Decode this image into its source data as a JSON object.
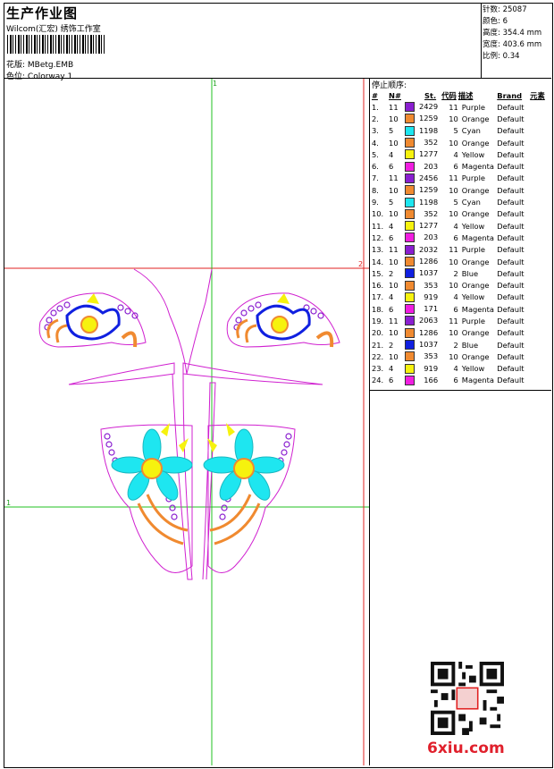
{
  "header": {
    "title": "生产作业图",
    "company": "Wilcom(汇宏) 绣饰工作室",
    "pattern_label": "花版:",
    "pattern_value": "MBetg.EMB",
    "colorway_label": "色位:",
    "colorway_value": "Colorway 1"
  },
  "stats": {
    "stitches_label": "针数:",
    "stitches": "25087",
    "colors_label": "颜色:",
    "colors": "6",
    "height_label": "高度:",
    "height": "354.4 mm",
    "width_label": "宽度:",
    "width": "403.6 mm",
    "scale_label": "比例:",
    "scale": "0.34"
  },
  "stop_sequence": {
    "title": "停止顺序:",
    "headers": [
      "#",
      "N#",
      "St.",
      "代码",
      "描述",
      "Brand",
      "元素"
    ],
    "rows": [
      {
        "idx": "1.",
        "n": "11",
        "color": "#8a1fd0",
        "st": "2429",
        "code": "11",
        "desc": "Purple",
        "brand": "Default"
      },
      {
        "idx": "2.",
        "n": "10",
        "color": "#f08a30",
        "st": "1259",
        "code": "10",
        "desc": "Orange",
        "brand": "Default"
      },
      {
        "idx": "3.",
        "n": "5",
        "color": "#1ee6f0",
        "st": "1198",
        "code": "5",
        "desc": "Cyan",
        "brand": "Default"
      },
      {
        "idx": "4.",
        "n": "10",
        "color": "#f08a30",
        "st": "352",
        "code": "10",
        "desc": "Orange",
        "brand": "Default"
      },
      {
        "idx": "5.",
        "n": "4",
        "color": "#f6f20e",
        "st": "1277",
        "code": "4",
        "desc": "Yellow",
        "brand": "Default"
      },
      {
        "idx": "6.",
        "n": "6",
        "color": "#f01ee0",
        "st": "203",
        "code": "6",
        "desc": "Magenta",
        "brand": "Default"
      },
      {
        "idx": "7.",
        "n": "11",
        "color": "#8a1fd0",
        "st": "2456",
        "code": "11",
        "desc": "Purple",
        "brand": "Default"
      },
      {
        "idx": "8.",
        "n": "10",
        "color": "#f08a30",
        "st": "1259",
        "code": "10",
        "desc": "Orange",
        "brand": "Default"
      },
      {
        "idx": "9.",
        "n": "5",
        "color": "#1ee6f0",
        "st": "1198",
        "code": "5",
        "desc": "Cyan",
        "brand": "Default"
      },
      {
        "idx": "10.",
        "n": "10",
        "color": "#f08a30",
        "st": "352",
        "code": "10",
        "desc": "Orange",
        "brand": "Default"
      },
      {
        "idx": "11.",
        "n": "4",
        "color": "#f6f20e",
        "st": "1277",
        "code": "4",
        "desc": "Yellow",
        "brand": "Default"
      },
      {
        "idx": "12.",
        "n": "6",
        "color": "#f01ee0",
        "st": "203",
        "code": "6",
        "desc": "Magenta",
        "brand": "Default"
      },
      {
        "idx": "13.",
        "n": "11",
        "color": "#8a1fd0",
        "st": "2032",
        "code": "11",
        "desc": "Purple",
        "brand": "Default"
      },
      {
        "idx": "14.",
        "n": "10",
        "color": "#f08a30",
        "st": "1286",
        "code": "10",
        "desc": "Orange",
        "brand": "Default"
      },
      {
        "idx": "15.",
        "n": "2",
        "color": "#1020e0",
        "st": "1037",
        "code": "2",
        "desc": "Blue",
        "brand": "Default"
      },
      {
        "idx": "16.",
        "n": "10",
        "color": "#f08a30",
        "st": "353",
        "code": "10",
        "desc": "Orange",
        "brand": "Default"
      },
      {
        "idx": "17.",
        "n": "4",
        "color": "#f6f20e",
        "st": "919",
        "code": "4",
        "desc": "Yellow",
        "brand": "Default"
      },
      {
        "idx": "18.",
        "n": "6",
        "color": "#f01ee0",
        "st": "171",
        "code": "6",
        "desc": "Magenta",
        "brand": "Default"
      },
      {
        "idx": "19.",
        "n": "11",
        "color": "#8a1fd0",
        "st": "2063",
        "code": "11",
        "desc": "Purple",
        "brand": "Default"
      },
      {
        "idx": "20.",
        "n": "10",
        "color": "#f08a30",
        "st": "1286",
        "code": "10",
        "desc": "Orange",
        "brand": "Default"
      },
      {
        "idx": "21.",
        "n": "2",
        "color": "#1020e0",
        "st": "1037",
        "code": "2",
        "desc": "Blue",
        "brand": "Default"
      },
      {
        "idx": "22.",
        "n": "10",
        "color": "#f08a30",
        "st": "353",
        "code": "10",
        "desc": "Orange",
        "brand": "Default"
      },
      {
        "idx": "23.",
        "n": "4",
        "color": "#f6f20e",
        "st": "919",
        "code": "4",
        "desc": "Yellow",
        "brand": "Default"
      },
      {
        "idx": "24.",
        "n": "6",
        "color": "#f01ee0",
        "st": "166",
        "code": "6",
        "desc": "Magenta",
        "brand": "Default"
      }
    ]
  },
  "guides": {
    "h1": "2",
    "h2": "1",
    "v1": "1"
  },
  "watermark": "6xiu.com"
}
